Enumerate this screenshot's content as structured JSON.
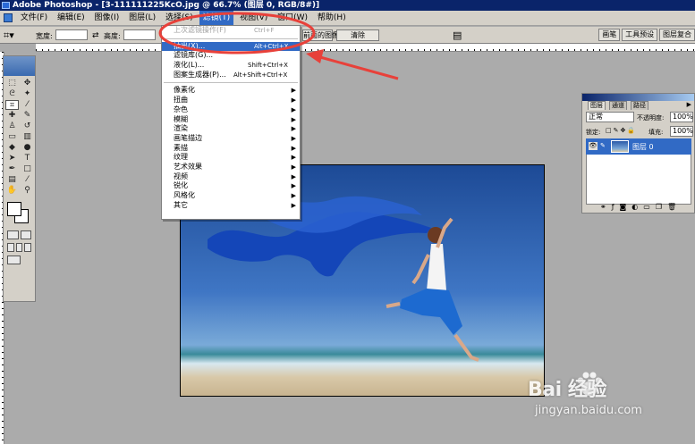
{
  "window": {
    "title": "Adobe Photoshop - [3-111111225KcO.jpg @ 66.7% (图层 0, RGB/8#)]"
  },
  "menubar": {
    "items": [
      {
        "label": "文件(F)"
      },
      {
        "label": "编辑(E)"
      },
      {
        "label": "图像(I)"
      },
      {
        "label": "图层(L)"
      },
      {
        "label": "选择(S)"
      },
      {
        "label": "滤镜(T)",
        "active": true
      },
      {
        "label": "视图(V)"
      },
      {
        "label": "窗口(W)"
      },
      {
        "label": "帮助(H)"
      }
    ]
  },
  "options_bar": {
    "width_label": "宽度:",
    "height_label": "高度:",
    "front_image_button": "前面的图像",
    "clear_button": "清除",
    "panel_tabs": [
      "画笔",
      "工具预设",
      "图层复合"
    ]
  },
  "filter_menu": {
    "items": [
      {
        "label": "上次滤镜操作(F)",
        "shortcut": "Ctrl+F",
        "disabled": true
      },
      {
        "sep": true
      },
      {
        "label": "抽出(X)...",
        "shortcut": "Alt+Ctrl+X",
        "highlight": true
      },
      {
        "label": "滤镜库(G)..."
      },
      {
        "label": "液化(L)...",
        "shortcut": "Shift+Ctrl+X"
      },
      {
        "label": "图案生成器(P)...",
        "shortcut": "Alt+Shift+Ctrl+X",
        "long": true
      },
      {
        "sep": true
      },
      {
        "label": "像素化",
        "submenu": true
      },
      {
        "label": "扭曲",
        "submenu": true
      },
      {
        "label": "杂色",
        "submenu": true
      },
      {
        "label": "模糊",
        "submenu": true
      },
      {
        "label": "渲染",
        "submenu": true
      },
      {
        "label": "画笔描边",
        "submenu": true
      },
      {
        "label": "素描",
        "submenu": true
      },
      {
        "label": "纹理",
        "submenu": true
      },
      {
        "label": "艺术效果",
        "submenu": true
      },
      {
        "label": "视频",
        "submenu": true
      },
      {
        "label": "锐化",
        "submenu": true
      },
      {
        "label": "风格化",
        "submenu": true
      },
      {
        "label": "其它",
        "submenu": true
      }
    ]
  },
  "layers_panel": {
    "tabs": [
      "图层",
      "通道",
      "路径"
    ],
    "blend_mode": "正常",
    "opacity_label": "不透明度:",
    "opacity": "100%",
    "lock_label": "锁定:",
    "fill_label": "填充:",
    "fill": "100%",
    "layers": [
      {
        "name": "图层 0",
        "visible": true,
        "selected": true
      }
    ]
  },
  "watermark": {
    "logo": "Bai 经验",
    "url": "jingyan.baidu.com"
  },
  "colors": {
    "accent": "#316ac5",
    "annotation": "#e8413a",
    "title_bar": "#0a246a"
  }
}
